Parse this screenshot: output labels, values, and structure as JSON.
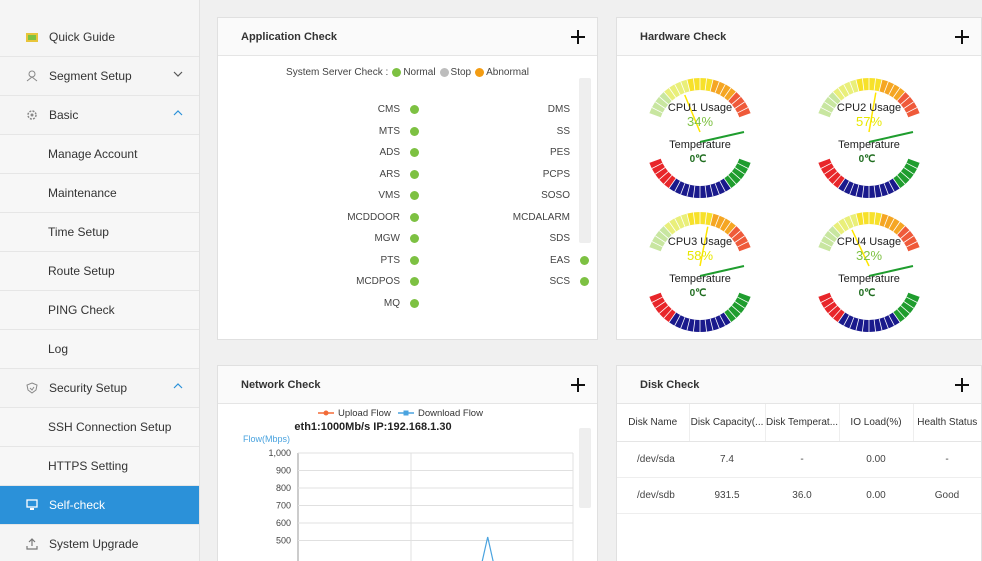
{
  "sidebar": {
    "items": [
      {
        "label": "Quick Guide",
        "icon": "quick-guide-icon"
      },
      {
        "label": "Segment Setup",
        "icon": "segment-icon",
        "expanded": false
      },
      {
        "label": "Basic",
        "icon": "gear-icon",
        "expanded": true
      },
      {
        "label": "Security Setup",
        "icon": "shield-icon",
        "expanded": true
      },
      {
        "label": "Self-check",
        "icon": "monitor-icon",
        "active": true
      },
      {
        "label": "System Upgrade",
        "icon": "upload-icon"
      }
    ],
    "basic_sub": [
      "Manage Account",
      "Maintenance",
      "Time Setup",
      "Route Setup",
      "PING Check",
      "Log"
    ],
    "security_sub": [
      "SSH Connection Setup",
      "HTTPS Setting"
    ]
  },
  "app_check": {
    "title": "Application Check",
    "legend_label": "System Server Check :",
    "legend": [
      {
        "label": "Normal",
        "color": "#7dc142"
      },
      {
        "label": "Stop",
        "color": "#bdbdbd"
      },
      {
        "label": "Abnormal",
        "color": "#f39c12"
      }
    ],
    "left_services": [
      "CMS",
      "MTS",
      "ADS",
      "ARS",
      "VMS",
      "MCDDOOR",
      "MGW",
      "PTS",
      "MCDPOS",
      "MQ"
    ],
    "right_services": [
      "DMS",
      "SS",
      "PES",
      "PCPS",
      "SOSO",
      "MCDALARM",
      "SDS",
      "EAS",
      "SCS"
    ]
  },
  "hardware_check": {
    "title": "Hardware Check",
    "gauges": [
      {
        "label": "CPU1 Usage",
        "value": "34%",
        "usage": 34,
        "temp_label": "Temperature",
        "temp": "0℃",
        "value_color": "#7dc142"
      },
      {
        "label": "CPU2 Usage",
        "value": "57%",
        "usage": 57,
        "temp_label": "Temperature",
        "temp": "0℃",
        "value_color": "#e8e800"
      },
      {
        "label": "CPU3 Usage",
        "value": "58%",
        "usage": 58,
        "temp_label": "Temperature",
        "temp": "0℃",
        "value_color": "#e8e800"
      },
      {
        "label": "CPU4 Usage",
        "value": "32%",
        "usage": 32,
        "temp_label": "Temperature",
        "temp": "0℃",
        "value_color": "#7dc142"
      }
    ]
  },
  "network_check": {
    "title": "Network Check",
    "legend_upload": "Upload Flow",
    "legend_download": "Download Flow",
    "chart_title": "eth1:1000Mb/s IP:192.168.1.30",
    "ylabel": "Flow(Mbps)",
    "upload_color": "#f26b38",
    "download_color": "#4aa3df"
  },
  "chart_data": {
    "type": "line",
    "title": "eth1:1000Mb/s IP:192.168.1.30",
    "ylabel": "Flow(Mbps)",
    "yticks": [
      "1,000",
      "900",
      "800",
      "700",
      "600",
      "500"
    ],
    "ylim": [
      0,
      1000
    ],
    "series": [
      {
        "name": "Upload Flow",
        "values": []
      },
      {
        "name": "Download Flow",
        "values": [
          0,
          0,
          0,
          0,
          0,
          0,
          0,
          0,
          0,
          0,
          0,
          0,
          0,
          0,
          0,
          0,
          0,
          0,
          0,
          0,
          520,
          0,
          0,
          0,
          0,
          0,
          0,
          0,
          0,
          0
        ]
      }
    ],
    "grid": true
  },
  "disk_check": {
    "title": "Disk Check",
    "columns": [
      "Disk Name",
      "Disk Capacity(...",
      "Disk Temperat...",
      "IO Load(%)",
      "Health Status"
    ],
    "rows": [
      [
        "/dev/sda",
        "7.4",
        "-",
        "0.00",
        "-"
      ],
      [
        "/dev/sdb",
        "931.5",
        "36.0",
        "0.00",
        "Good"
      ]
    ]
  }
}
